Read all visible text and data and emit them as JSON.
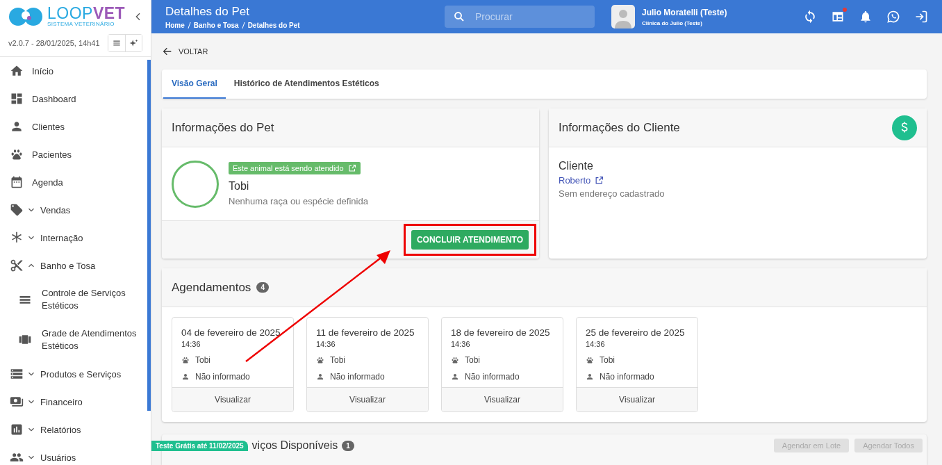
{
  "brand": {
    "name_a": "LOOP",
    "name_b": "VET",
    "tagline": "SISTEMA VETERINÁRIO",
    "version": "v2.0.7 - 28/01/2025, 14h41"
  },
  "sidebar": {
    "items": [
      {
        "label": "Início",
        "kind": "plain"
      },
      {
        "label": "Dashboard",
        "kind": "plain"
      },
      {
        "label": "Clientes",
        "kind": "plain"
      },
      {
        "label": "Pacientes",
        "kind": "plain"
      },
      {
        "label": "Agenda",
        "kind": "plain"
      },
      {
        "label": "Vendas",
        "kind": "group",
        "expanded": false
      },
      {
        "label": "Internação",
        "kind": "group",
        "expanded": false
      },
      {
        "label": "Banho e Tosa",
        "kind": "group",
        "expanded": true,
        "children": [
          {
            "label": "Controle de Serviços Estéticos"
          },
          {
            "label": "Grade de Atendimentos Estéticos"
          }
        ]
      },
      {
        "label": "Produtos e Serviços",
        "kind": "group",
        "expanded": false
      },
      {
        "label": "Financeiro",
        "kind": "group",
        "expanded": false
      },
      {
        "label": "Relatórios",
        "kind": "group",
        "expanded": false
      },
      {
        "label": "Usuários",
        "kind": "group",
        "expanded": false
      }
    ]
  },
  "header": {
    "title": "Detalhes do Pet",
    "breadcrumb": [
      "Home",
      "Banho e Tosa",
      "Detalhes do Pet"
    ],
    "search": {
      "placeholder": "Procurar"
    },
    "user": {
      "name": "Julio Moratelli (Teste)",
      "clinic": "Clínica do Julio (Teste)"
    },
    "calendar_alert": true
  },
  "back": "VOLTAR",
  "tabs": [
    {
      "label": "Visão Geral",
      "selected": true
    },
    {
      "label": "Histórico de Atendimentos Estéticos",
      "selected": false
    }
  ],
  "pet_card": {
    "title": "Informações do Pet",
    "status_badge": "Este animal está sendo atendido",
    "name": "Tobi",
    "species": "Nenhuma raça ou espécie definida",
    "action": "CONCLUIR ATENDIMENTO"
  },
  "client_card": {
    "title": "Informações do Cliente",
    "label": "Cliente",
    "client": "Roberto",
    "address": "Sem endereço cadastrado"
  },
  "appointments": {
    "title": "Agendamentos",
    "count": "4",
    "items": [
      {
        "date": "04 de fevereiro de 2025",
        "time": "14:36",
        "pet": "Tobi",
        "staff": "Não informado",
        "action": "Visualizar"
      },
      {
        "date": "11 de fevereiro de 2025",
        "time": "14:36",
        "pet": "Tobi",
        "staff": "Não informado",
        "action": "Visualizar"
      },
      {
        "date": "18 de fevereiro de 2025",
        "time": "14:36",
        "pet": "Tobi",
        "staff": "Não informado",
        "action": "Visualizar"
      },
      {
        "date": "25 de fevereiro de 2025",
        "time": "14:36",
        "pet": "Tobi",
        "staff": "Não informado",
        "action": "Visualizar"
      }
    ]
  },
  "services": {
    "title": "viços Disponíveis",
    "count": "1",
    "buttons": [
      {
        "label": "Agendar em Lote",
        "disabled": true
      },
      {
        "label": "Agendar Todos",
        "disabled": true
      }
    ]
  },
  "trial_badge": "Teste Grátis até 11/02/2025"
}
